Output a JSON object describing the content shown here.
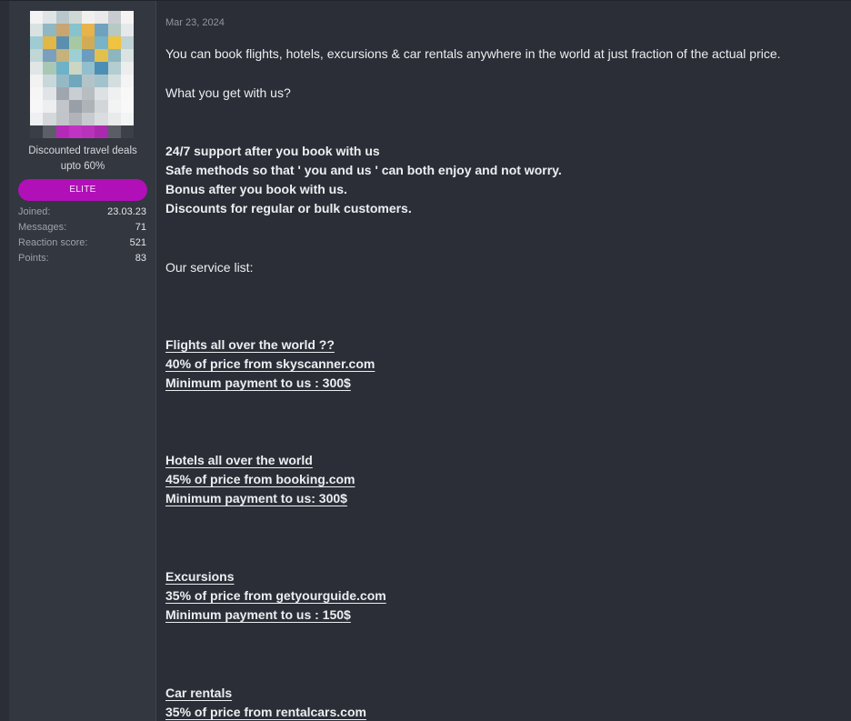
{
  "user": {
    "title_line1": "Discounted travel deals",
    "title_line2": "upto 60%",
    "banner": "ELITE",
    "banner_color": "#b10fb8",
    "avatar_state": "pixelated",
    "stats": [
      {
        "label": "Joined:",
        "value": "23.03.23"
      },
      {
        "label": "Messages:",
        "value": "71"
      },
      {
        "label": "Reaction score:",
        "value": "521"
      },
      {
        "label": "Points:",
        "value": "83"
      }
    ]
  },
  "post": {
    "date": "Mar 23, 2024",
    "intro": "You can book flights, hotels, excursions & car rentals anywhere in the world at just fraction of the actual price.",
    "question": "What you get with us?",
    "benefits": [
      "24/7 support after you book with us",
      "Safe methods so that ' you and us ' can both enjoy and not worry.",
      "Bonus after you book with us.",
      "Discounts for regular or bulk customers."
    ],
    "service_heading": "Our service list:",
    "services": [
      {
        "name": "Flights all over the world ??",
        "price": "40% of price from skyscanner.com",
        "minimum": "Minimum payment to us : 300$"
      },
      {
        "name": "Hotels all over the world",
        "price": "45% of price from booking.com",
        "minimum": "Minimum payment to us: 300$"
      },
      {
        "name": "Excursions",
        "price": "35% of price from getyourguide.com",
        "minimum": "Minimum payment to us : 150$"
      },
      {
        "name": "Car rentals",
        "price": "35% of price from rentalcars.com"
      }
    ]
  }
}
